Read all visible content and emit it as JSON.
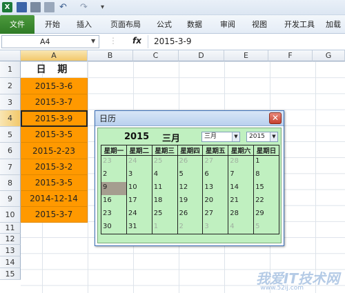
{
  "ribbon": {
    "tabs": [
      "文件",
      "开始",
      "插入",
      "页面布局",
      "公式",
      "数据",
      "审阅",
      "视图",
      "开发工具",
      "加载"
    ]
  },
  "formula_bar": {
    "name_box": "A4",
    "fx_label": "fx",
    "content": "2015-3-9"
  },
  "sheet": {
    "columns": [
      "A",
      "B",
      "C",
      "D",
      "E",
      "F",
      "G"
    ],
    "rows": [
      "1",
      "2",
      "3",
      "4",
      "5",
      "6",
      "7",
      "8",
      "9",
      "10",
      "11",
      "12",
      "13",
      "14",
      "15"
    ],
    "col_a_values": [
      "日 期",
      "2015-3-6",
      "2015-3-7",
      "2015-3-9",
      "2015-3-5",
      "2015-2-23",
      "2015-3-2",
      "2015-3-5",
      "2014-12-14",
      "2015-3-7"
    ],
    "highlight_color": "#ff9900"
  },
  "calendar_dialog": {
    "title": "日历",
    "close_glyph": "✕",
    "year_label": "2015",
    "month_label": "三月",
    "month_select": "三月",
    "year_select": "2015",
    "weekdays": [
      "星期一",
      "星期二",
      "星期三",
      "星期四",
      "星期五",
      "星期六",
      "星期日"
    ],
    "weeks": [
      [
        {
          "d": "23",
          "o": true
        },
        {
          "d": "24",
          "o": true
        },
        {
          "d": "25",
          "o": true
        },
        {
          "d": "26",
          "o": true
        },
        {
          "d": "27",
          "o": true
        },
        {
          "d": "28",
          "o": true
        },
        {
          "d": "1"
        }
      ],
      [
        {
          "d": "2"
        },
        {
          "d": "3"
        },
        {
          "d": "4"
        },
        {
          "d": "5"
        },
        {
          "d": "6"
        },
        {
          "d": "7"
        },
        {
          "d": "8"
        }
      ],
      [
        {
          "d": "9",
          "today": true
        },
        {
          "d": "10"
        },
        {
          "d": "11"
        },
        {
          "d": "12"
        },
        {
          "d": "13"
        },
        {
          "d": "14"
        },
        {
          "d": "15"
        }
      ],
      [
        {
          "d": "16"
        },
        {
          "d": "17"
        },
        {
          "d": "18"
        },
        {
          "d": "19"
        },
        {
          "d": "20"
        },
        {
          "d": "21"
        },
        {
          "d": "22"
        }
      ],
      [
        {
          "d": "23"
        },
        {
          "d": "24"
        },
        {
          "d": "25"
        },
        {
          "d": "26"
        },
        {
          "d": "27"
        },
        {
          "d": "28"
        },
        {
          "d": "29"
        }
      ],
      [
        {
          "d": "30"
        },
        {
          "d": "31"
        },
        {
          "d": "1",
          "o": true
        },
        {
          "d": "2",
          "o": true
        },
        {
          "d": "3",
          "o": true
        },
        {
          "d": "4",
          "o": true
        },
        {
          "d": "5",
          "o": true
        }
      ]
    ],
    "background_color": "#c0f0c0"
  },
  "watermark": {
    "text": "我爱IT技术网",
    "url": "www.52ij.com"
  }
}
